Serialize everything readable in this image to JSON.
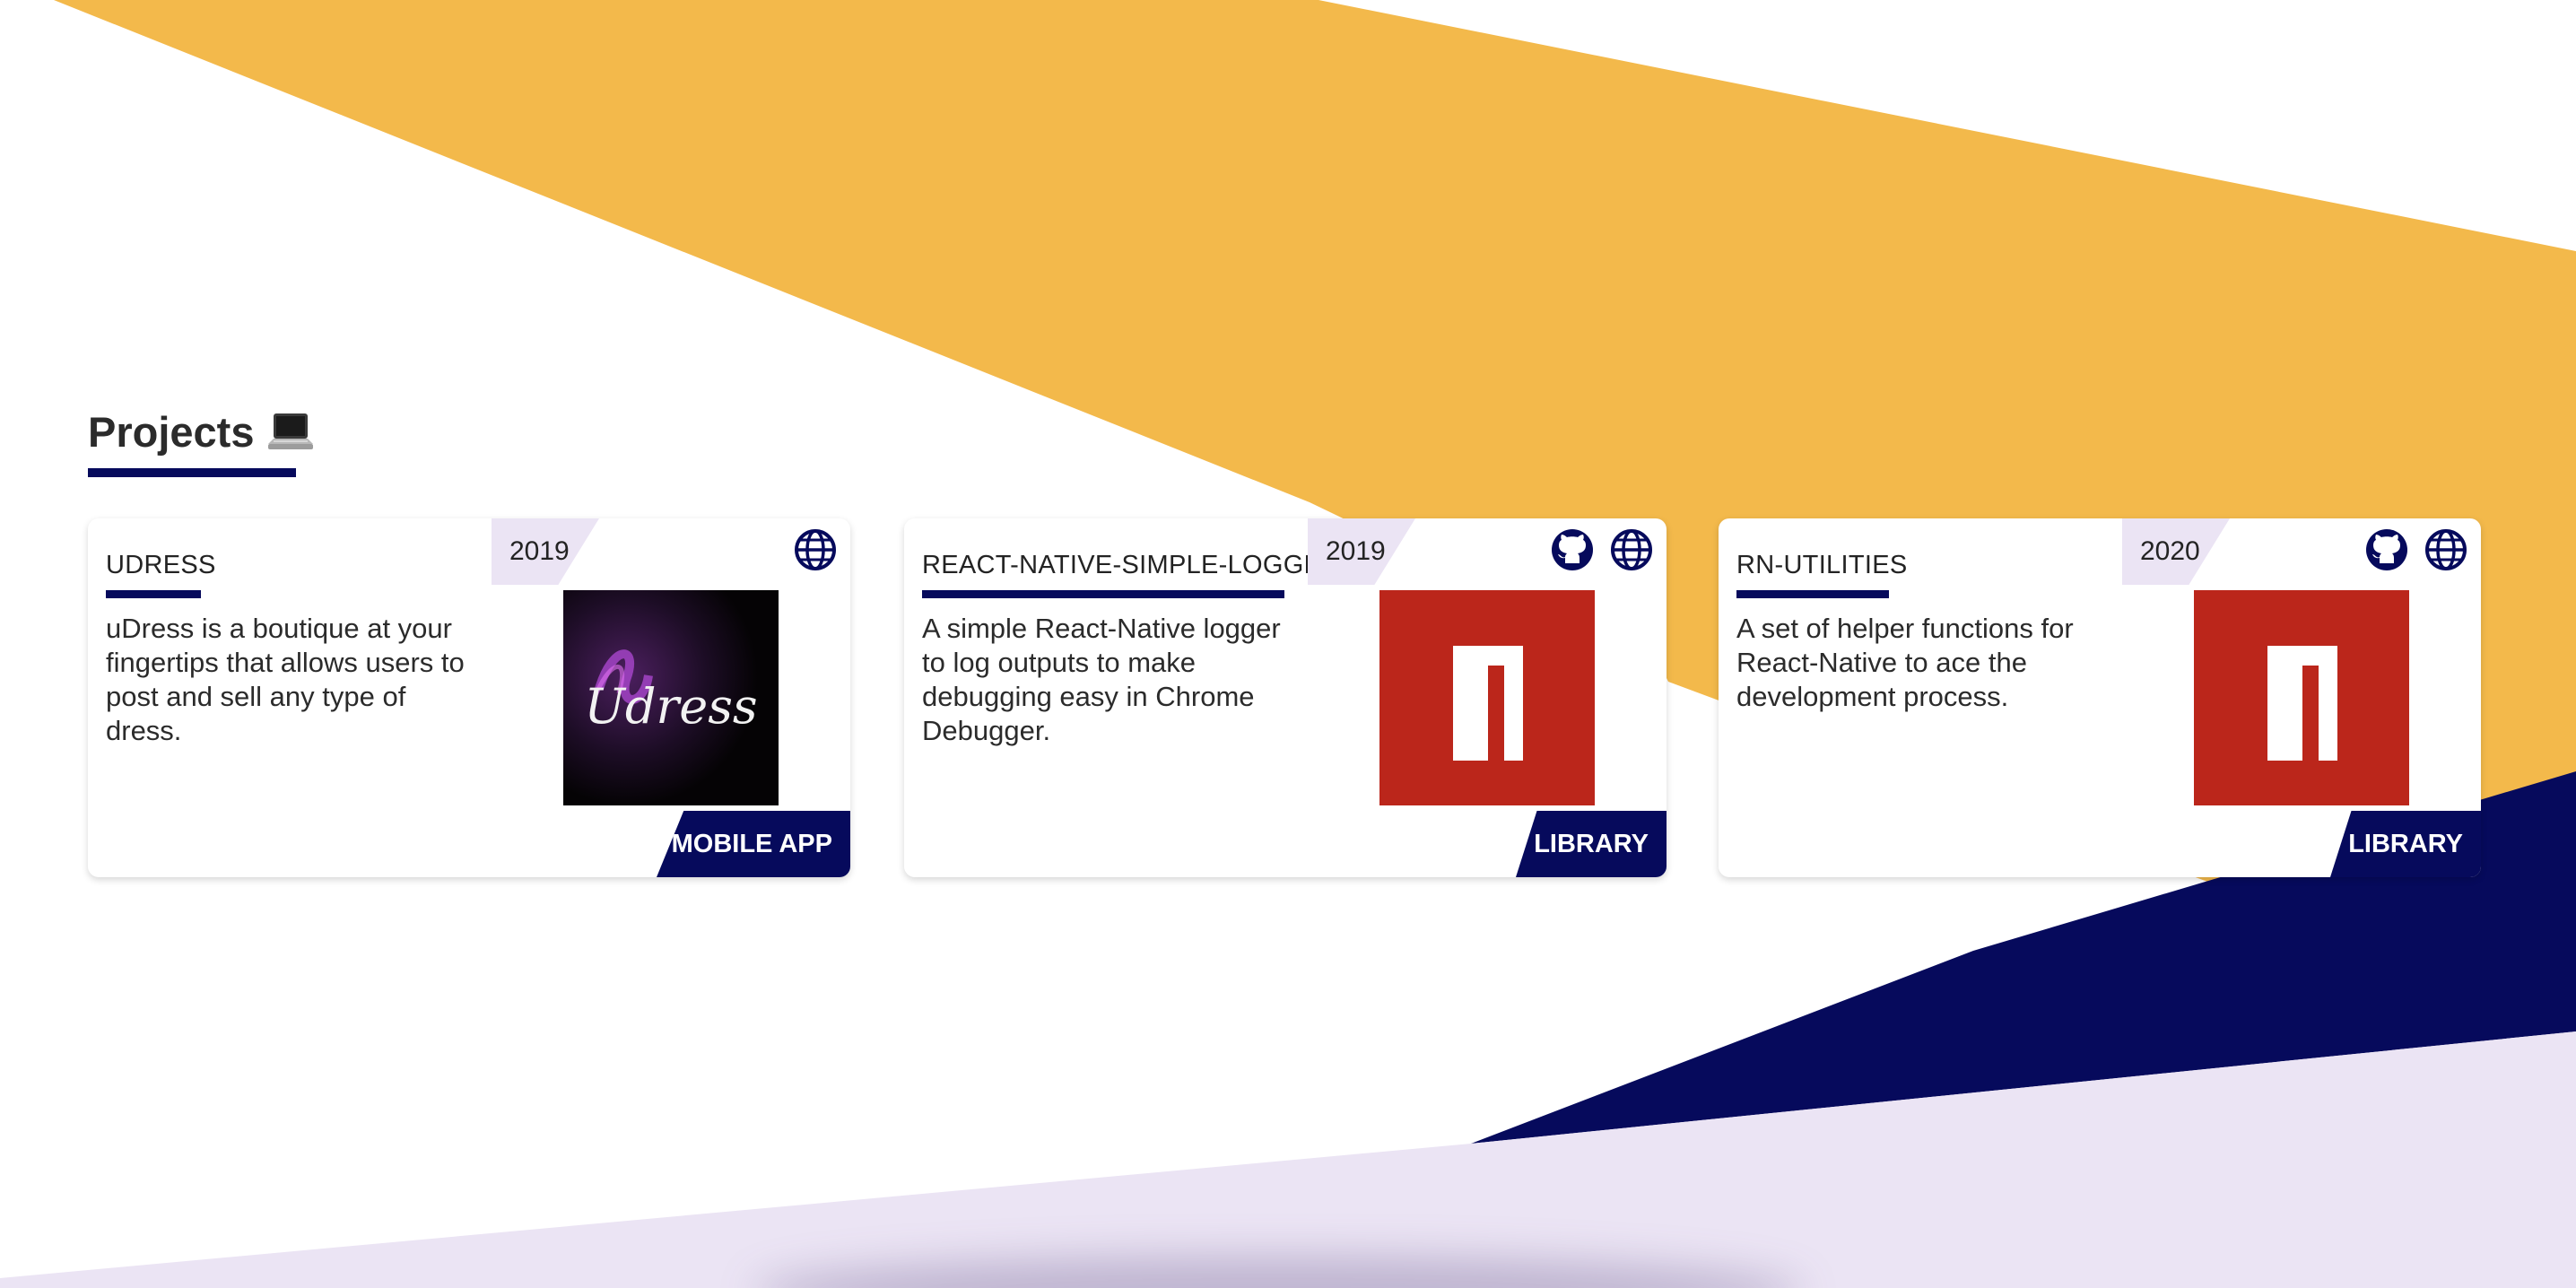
{
  "section": {
    "title": "Projects",
    "icon": "laptop-icon"
  },
  "colors": {
    "accent_navy": "#060a5c",
    "accent_yellow": "#f3b94b",
    "accent_lavender": "#ebe4f4",
    "logo_red": "#bb261b"
  },
  "projects": [
    {
      "title": "UDRESS",
      "year": "2019",
      "description": "uDress is a boutique at your fingertips that allows users to post and sell any type of dress.",
      "type": "MOBILE APP",
      "thumbnail_text": "Udress",
      "links": [
        "globe-icon"
      ]
    },
    {
      "title": "REACT-NATIVE-SIMPLE-LOGGER",
      "year": "2019",
      "description": "A simple React-Native logger to log outputs to make debugging easy in Chrome Debugger.",
      "type": "LIBRARY",
      "thumbnail_icon": "npm-logo-icon",
      "links": [
        "github-icon",
        "globe-icon"
      ]
    },
    {
      "title": "RN-UTILITIES",
      "year": "2020",
      "description": "A set of helper functions for React-Native to ace the development process.",
      "type": "LIBRARY",
      "thumbnail_icon": "npm-logo-icon",
      "links": [
        "github-icon",
        "globe-icon"
      ]
    }
  ]
}
